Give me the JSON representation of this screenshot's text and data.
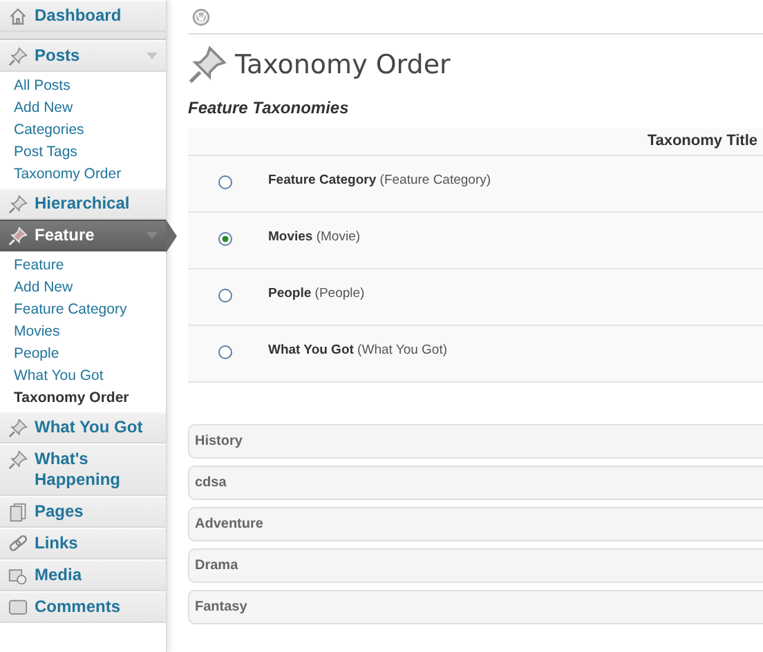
{
  "sidebar": {
    "items": [
      {
        "label": "Dashboard",
        "current": false,
        "expanded": false
      },
      {
        "label": "Posts",
        "current": false,
        "expanded": true,
        "children": [
          {
            "label": "All Posts",
            "selected": false
          },
          {
            "label": "Add New",
            "selected": false
          },
          {
            "label": "Categories",
            "selected": false
          },
          {
            "label": "Post Tags",
            "selected": false
          },
          {
            "label": "Taxonomy Order",
            "selected": false
          }
        ]
      },
      {
        "label": "Hierarchical",
        "current": false,
        "expanded": false
      },
      {
        "label": "Feature",
        "current": true,
        "expanded": true,
        "children": [
          {
            "label": "Feature",
            "selected": false
          },
          {
            "label": "Add New",
            "selected": false
          },
          {
            "label": "Feature Category",
            "selected": false
          },
          {
            "label": "Movies",
            "selected": false
          },
          {
            "label": "People",
            "selected": false
          },
          {
            "label": "What You Got",
            "selected": false
          },
          {
            "label": "Taxonomy Order",
            "selected": true
          }
        ]
      },
      {
        "label": "What You Got",
        "current": false,
        "expanded": false
      },
      {
        "label": "What's Happening",
        "current": false,
        "expanded": false
      },
      {
        "label": "Pages",
        "current": false,
        "expanded": false
      },
      {
        "label": "Links",
        "current": false,
        "expanded": false
      },
      {
        "label": "Media",
        "current": false,
        "expanded": false
      },
      {
        "label": "Comments",
        "current": false,
        "expanded": false
      }
    ]
  },
  "page": {
    "title": "Taxonomy Order",
    "section_title": "Feature Taxonomies"
  },
  "table": {
    "columns": [
      "Taxonomy Title"
    ],
    "rows": [
      {
        "title": "**Feature Category** (Feature Category)",
        "selected": false
      },
      {
        "title": "**Movies** (Movie)",
        "selected": true
      },
      {
        "title": "**People** (People)",
        "selected": false
      },
      {
        "title": "**What You Got** (What You Got)",
        "selected": false
      }
    ]
  },
  "terms": [
    "History",
    "cdsa",
    "Adventure",
    "Drama",
    "Fantasy"
  ]
}
